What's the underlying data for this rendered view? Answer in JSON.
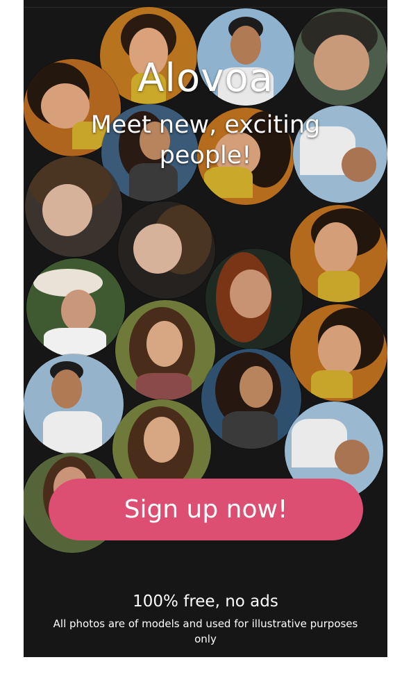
{
  "app": {
    "title": "Alovoa",
    "tagline": "Meet new, exciting people!"
  },
  "cta": {
    "label": "Sign up now!"
  },
  "footer": {
    "free_label": "100% free, no ads",
    "disclaimer": "All photos are of models and used for illustrative purposes only"
  },
  "colors": {
    "background": "#161616",
    "accent": "#dc4f73",
    "text": "#ffffff"
  }
}
